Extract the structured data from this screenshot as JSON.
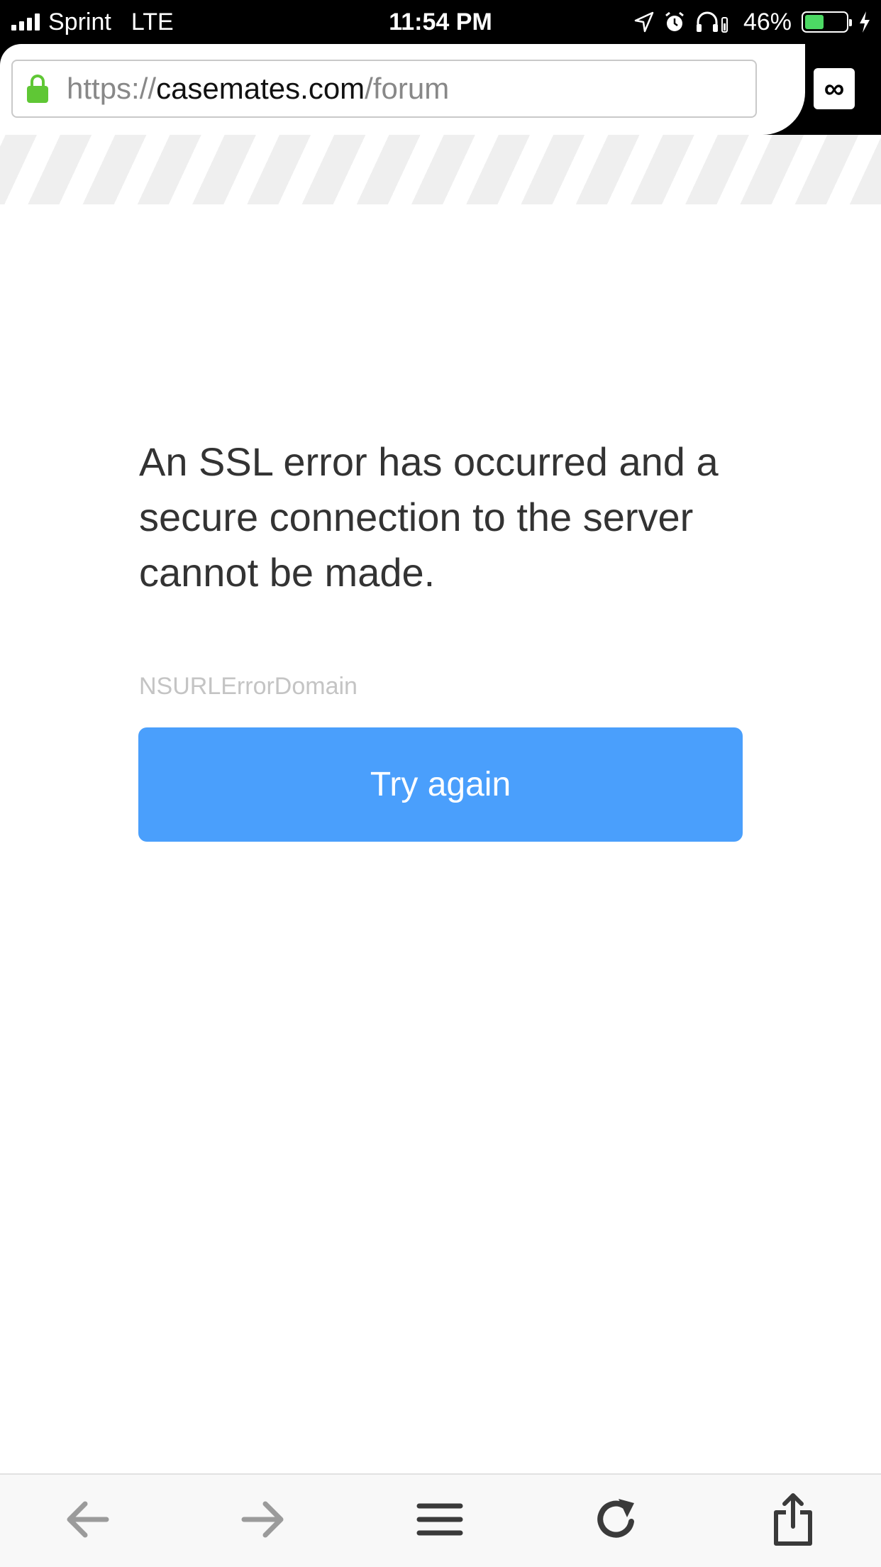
{
  "status_bar": {
    "carrier": "Sprint",
    "network": "LTE",
    "time": "11:54 PM",
    "battery_percent": "46%",
    "battery_level": 0.46,
    "icons": [
      "location-arrow-icon",
      "alarm-icon",
      "headphones-icon",
      "charging-bolt-icon"
    ]
  },
  "browser": {
    "url_scheme": "https://",
    "url_host": "casemates.com",
    "url_path": "/forum",
    "tabs_label": "∞",
    "accent_lock_color": "#5fc735"
  },
  "error": {
    "message": "An SSL error has occurred and a secure connection to the server cannot be made.",
    "domain": "NSURLErrorDomain",
    "retry_label": "Try again",
    "button_color": "#4a9ffc"
  },
  "toolbar": {
    "items": [
      "back-arrow-icon",
      "forward-arrow-icon",
      "menu-icon",
      "reload-icon",
      "share-icon"
    ]
  }
}
